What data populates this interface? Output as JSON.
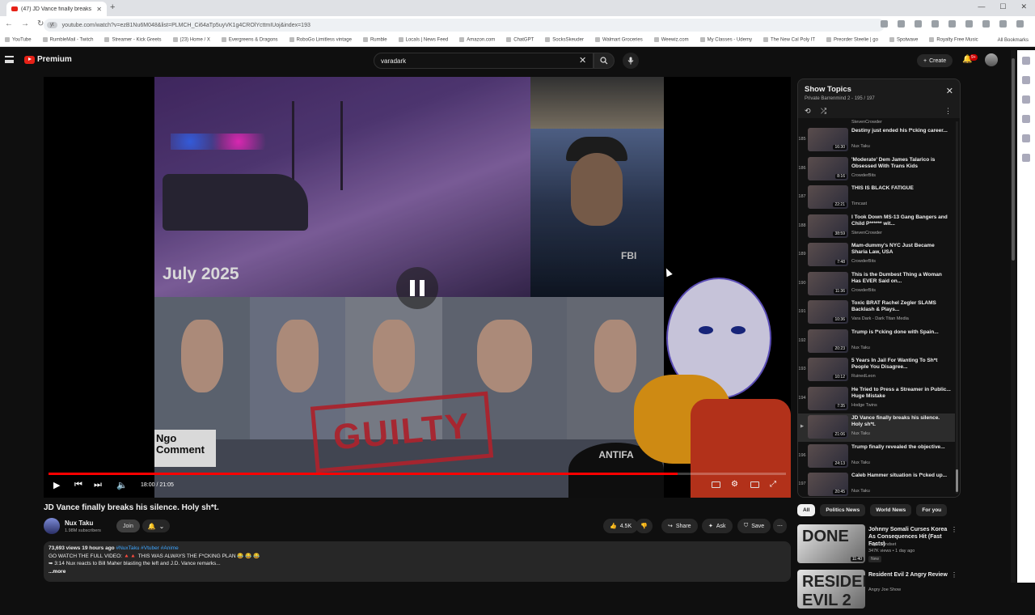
{
  "browser": {
    "tab_title": "(47) JD Vance finally breaks",
    "new_tab": "+",
    "url_pill": "yt",
    "url": "youtube.com/watch?v=ezB1Nu6M048&list=PLMCH_Ci64aTp5uyVK1g4CROlYcttmIUoj&index=193",
    "bookmarks": [
      "YouTube",
      "RumbleMail - Twitch",
      "Streamer - Kick Greets",
      "(23) Home / X",
      "Evergreens & Dragons",
      "RoboGo Limitless vintage",
      "Rumble",
      "Locals | News Feed",
      "Amazon.com",
      "ChatGPT",
      "SocksSkeuder",
      "Walmart Groceries",
      "Weewiz.com",
      "My Classes - Udemy",
      "The New Cal Poly IT",
      "Preorder Steelie | go",
      "Spotwave",
      "Royalty Free Music"
    ],
    "all_bookmarks": "All Bookmarks"
  },
  "header": {
    "brand": "Premium",
    "search_value": "varadark",
    "create_label": "Create",
    "notif_count": "9+"
  },
  "video": {
    "overlay_date": "July 2025",
    "ngo_text": "Ngo Comment",
    "guilty_text": "GUILTY",
    "fbi_text": "FBI",
    "antifa_text": "ANTIFA",
    "time": "18:00 / 21:05",
    "progress": 0.853,
    "title": "JD Vance finally breaks his silence. Holy sh*t."
  },
  "channel": {
    "name": "Nux Taku",
    "subs": "1.98M subscribers",
    "join": "Join"
  },
  "actions": {
    "likes": "4.5K",
    "share": "Share",
    "ask": "Ask",
    "save": "Save"
  },
  "description": {
    "meta": "73,693 views  19 hours ago",
    "tags": "#NuxTaku #Vtuber #Anime",
    "line1": "GO WATCH THE FULL VIDEO: 🔺🔺 THIS WAS ALWAYS THE F*CKING PLAN 😂 😂 😂",
    "line2": "➥ 3:14 Nux reacts to Bill Maher blasting the left and J.D. Vance remarks...",
    "more": "...more"
  },
  "playlist": {
    "title": "Show Topics",
    "subtitle": "Private  Barrenmind 2 - 195 / 197",
    "top_channel": "StevenCrowder",
    "items": [
      {
        "idx": "185",
        "title": "Destiny just ended his f*cking career...",
        "channel": "Nux Taku",
        "dur": "16:30"
      },
      {
        "idx": "186",
        "title": "'Moderate' Dem James Talarico is Obsessed With Trans Kids",
        "channel": "CrowderBits",
        "dur": "8:16"
      },
      {
        "idx": "187",
        "title": "THIS IS BLACK FATIGUE",
        "channel": "Timcast",
        "dur": "22:21"
      },
      {
        "idx": "188",
        "title": "I Took Down MS-13 Gang Bangers and Child P****** wit...",
        "channel": "StevenCrowder",
        "dur": "38:59"
      },
      {
        "idx": "189",
        "title": "Mam-dummy's NYC Just Became Sharia Law, USA",
        "channel": "CrowderBits",
        "dur": "7:48"
      },
      {
        "idx": "190",
        "title": "This is the Dumbest Thing a Woman Has EVER Said on...",
        "channel": "CrowderBits",
        "dur": "11:36"
      },
      {
        "idx": "191",
        "title": "Toxic BRAT Rachel Zegler SLAMS Backlash & Plays...",
        "channel": "Vara Dark - Dark Titan Media",
        "dur": "10:36"
      },
      {
        "idx": "192",
        "title": "Trump is f*cking done with Spain...",
        "channel": "Nux Taku",
        "dur": "20:23"
      },
      {
        "idx": "193",
        "title": "5 Years In Jail For Wanting To Sh*t People You Disagree...",
        "channel": "RuinedLeon",
        "dur": "10:12"
      },
      {
        "idx": "194",
        "title": "He Tried to Press a Streamer in Public... Huge Mistake",
        "channel": "Hodge Twins",
        "dur": "7:35"
      },
      {
        "idx": "▶",
        "title": "JD Vance finally breaks his silence. Holy sh*t.",
        "channel": "Nux Taku",
        "dur": "21:06"
      },
      {
        "idx": "196",
        "title": "Trump finally revealed the objective...",
        "channel": "Nux Taku",
        "dur": "24:13"
      },
      {
        "idx": "197",
        "title": "Caleb Hammer situation is f*cked up...",
        "channel": "Nux Taku",
        "dur": "20:45"
      }
    ]
  },
  "chips": [
    "All",
    "Politics News",
    "World News",
    "For you"
  ],
  "recommended": [
    {
      "title": "Johnny Somali Curses Korea As Consequences Hit (Fast Facts)",
      "channel": "Legal Mindset",
      "meta": "347K views • 1 day ago",
      "badge": "New",
      "dur": "11:40",
      "thumb": "DONE"
    },
    {
      "title": "Resident Evil 2 Angry Review",
      "channel": "Angry Joe Show",
      "meta": "",
      "badge": "",
      "dur": "",
      "thumb": "RESIDENT EVIL 2"
    }
  ],
  "colors": {
    "accent": "#ff0000",
    "bg": "#0f0f0f",
    "guilty": "#c82a36"
  }
}
